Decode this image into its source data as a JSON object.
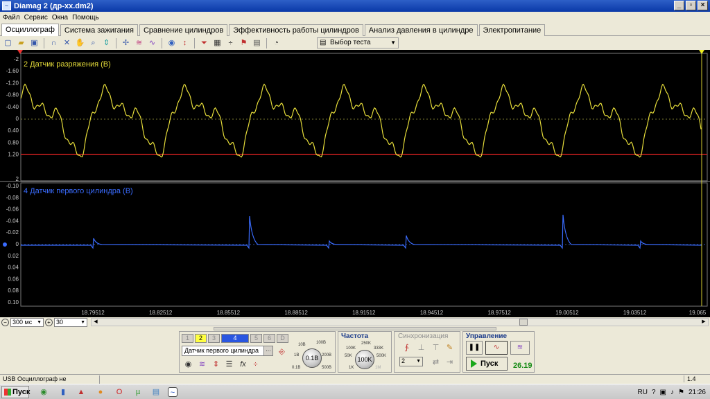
{
  "window": {
    "title": "Diamag 2 (др-хх.dm2)",
    "buttons": [
      "_",
      "▫",
      "×"
    ]
  },
  "menu": [
    "Файл",
    "Сервис",
    "Окна",
    "Помощь"
  ],
  "tabs": [
    {
      "label": "Осциллограф",
      "active": true
    },
    {
      "label": "Система зажигания",
      "active": false
    },
    {
      "label": "Сравнение цилиндров",
      "active": false
    },
    {
      "label": "Эффективность работы цилиндров",
      "active": false
    },
    {
      "label": "Анализ давления в цилиндре",
      "active": false
    },
    {
      "label": "Электропитание",
      "active": false
    }
  ],
  "toolbar": {
    "test_selector": "Выбор теста"
  },
  "scope": {
    "channel2": {
      "label": "2 Датчик разряжения (В)",
      "color": "#e6dd3a",
      "y_ticks": [
        "-2",
        "-1.60",
        "-1.20",
        "-0.80",
        "-0.40",
        "0",
        "0.40",
        "0.80",
        "1.20",
        "2"
      ]
    },
    "channel4": {
      "label": "4 Датчик первого цилиндра (В)",
      "color": "#3a6cff",
      "y_ticks": [
        "-0.10",
        "-0.08",
        "-0.06",
        "-0.04",
        "-0.02",
        "0",
        "0.02",
        "0.04",
        "0.06",
        "0.08",
        "0.10"
      ]
    },
    "x_ticks": [
      "18.79512",
      "18.82512",
      "18.85512",
      "18.88512",
      "18.91512",
      "18.94512",
      "18.97512",
      "19.00512",
      "19.03512",
      "19.065"
    ]
  },
  "controls": {
    "timebase": "300 мс",
    "count": "30"
  },
  "panel": {
    "channels": [
      "1",
      "2",
      "3",
      "4",
      "5",
      "6",
      "D"
    ],
    "channel_name": "Датчик первого цилиндра",
    "voltage_knob": "0.1В",
    "voltage_labels": [
      "10В",
      "100В",
      "1В",
      "200В",
      "0.1В",
      "500В"
    ],
    "frequency_title": "Частота",
    "frequency_knob": "100K",
    "frequency_labels": [
      "250K",
      "100K",
      "333K",
      "50K",
      "500K",
      "1K",
      "1M"
    ],
    "sync_title": "Синхронизация",
    "sync_value": "2",
    "control_title": "Управление",
    "start_button": "Пуск",
    "rpm_value": "26.19"
  },
  "status": {
    "left": "USB Осциллограф не подключен",
    "right": "1.4"
  },
  "taskbar": {
    "start": "Пуск",
    "lang": "RU",
    "clock": "21:26"
  }
}
